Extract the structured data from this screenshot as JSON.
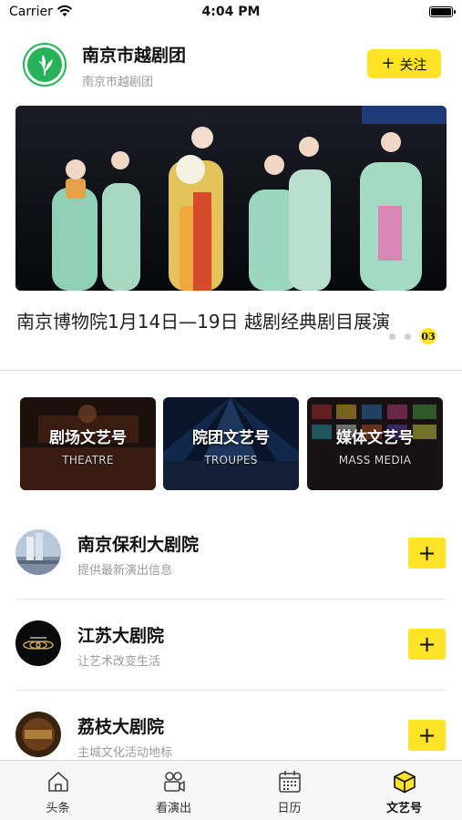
{
  "status_bar": {
    "carrier": "Carrier",
    "time": "4:04 PM"
  },
  "header": {
    "org_name": "南京市越剧团",
    "org_subtitle": "南京市越剧团",
    "follow_label": "关注",
    "follow_icon": "plus-icon"
  },
  "banner": {
    "title": "南京博物院1月14日—19日 越剧经典剧目展演",
    "page_indicator": "03",
    "total_dots": 3
  },
  "categories": [
    {
      "title": "剧场文艺号",
      "subtitle": "THEATRE"
    },
    {
      "title": "院团文艺号",
      "subtitle": "TROUPES"
    },
    {
      "title": "媒体文艺号",
      "subtitle": "MASS MEDIA"
    }
  ],
  "list": [
    {
      "title": "南京保利大剧院",
      "desc": "提供最新演出信息",
      "add_icon": "plus-icon"
    },
    {
      "title": "江苏大剧院",
      "desc": "让艺术改变生活",
      "add_icon": "plus-icon"
    },
    {
      "title": "荔枝大剧院",
      "desc": "主城文化活动地标",
      "add_icon": "plus-icon"
    }
  ],
  "tabbar": {
    "tabs": [
      {
        "label": "头条",
        "icon": "home-icon",
        "active": false
      },
      {
        "label": "看演出",
        "icon": "camera-icon",
        "active": false
      },
      {
        "label": "日历",
        "icon": "calendar-icon",
        "active": false
      },
      {
        "label": "文艺号",
        "icon": "cube-icon",
        "active": true
      }
    ]
  },
  "colors": {
    "accent": "#ffe326",
    "logo_green": "#27b25a"
  }
}
